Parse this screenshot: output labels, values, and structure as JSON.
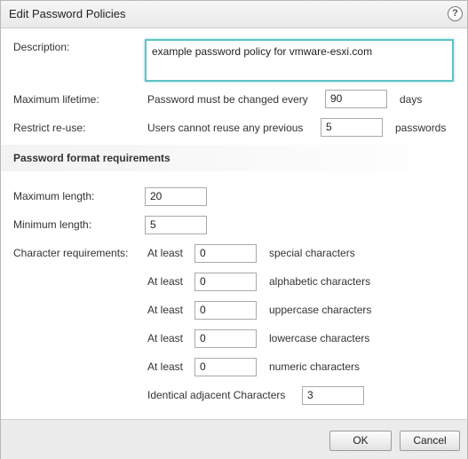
{
  "dialog": {
    "title": "Edit Password Policies",
    "help_symbol": "?"
  },
  "description": {
    "label": "Description:",
    "value": "example password policy for vmware-esxi.com"
  },
  "lifetime": {
    "label": "Maximum lifetime:",
    "prefix": "Password must be changed every",
    "value": "90",
    "suffix": "days"
  },
  "reuse": {
    "label": "Restrict re-use:",
    "prefix": "Users cannot reuse any previous",
    "value": "5",
    "suffix": "passwords"
  },
  "format_section": {
    "title": "Password format requirements"
  },
  "max_length": {
    "label": "Maximum length:",
    "value": "20"
  },
  "min_length": {
    "label": "Minimum length:",
    "value": "5"
  },
  "char_requirements": {
    "label": "Character requirements:",
    "at_least": "At least",
    "rows": [
      {
        "value": "0",
        "suffix": "special characters"
      },
      {
        "value": "0",
        "suffix": "alphabetic characters"
      },
      {
        "value": "0",
        "suffix": "uppercase characters"
      },
      {
        "value": "0",
        "suffix": "lowercase characters"
      },
      {
        "value": "0",
        "suffix": "numeric characters"
      }
    ],
    "identical_label": "Identical adjacent Characters",
    "identical_value": "3"
  },
  "footer": {
    "ok_label": "OK",
    "cancel_label": "Cancel"
  }
}
